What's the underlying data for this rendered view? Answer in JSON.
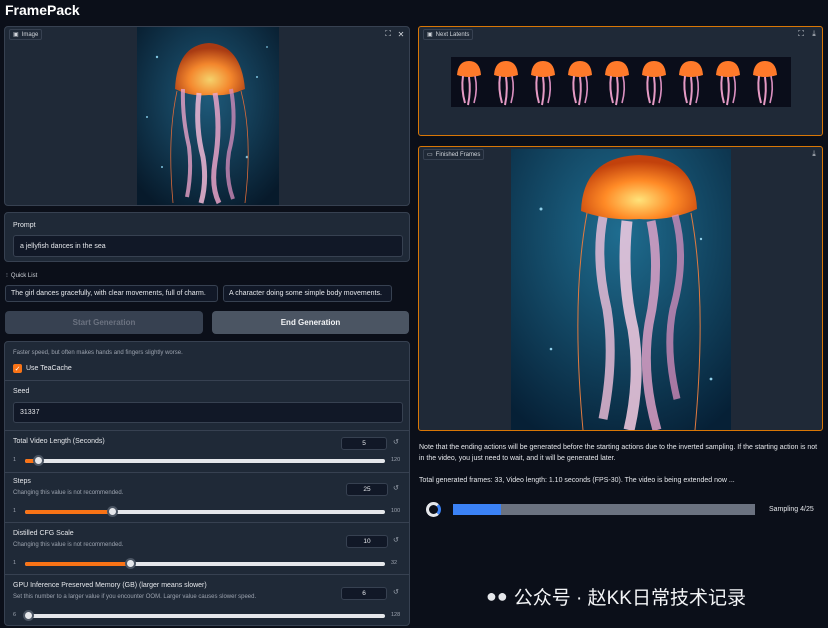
{
  "app": {
    "title": "FramePack"
  },
  "image_panel": {
    "label": "Image"
  },
  "latents_panel": {
    "label": "Next Latents"
  },
  "frames_panel": {
    "label": "Finished Frames"
  },
  "prompt": {
    "label": "Prompt",
    "value": "a jellyfish dances in the sea"
  },
  "quick_list": {
    "label": "Quick List",
    "items": [
      "The girl dances gracefully, with clear movements, full of charm.",
      "A character doing some simple body movements."
    ]
  },
  "buttons": {
    "start": "Start Generation",
    "end": "End Generation"
  },
  "teacache": {
    "hint": "Faster speed, but often makes hands and fingers slightly worse.",
    "label": "Use TeaCache",
    "checked": true
  },
  "seed": {
    "label": "Seed",
    "value": "31337"
  },
  "video_length": {
    "label": "Total Video Length (Seconds)",
    "value": "5",
    "min": "1",
    "max": "120"
  },
  "steps": {
    "label": "Steps",
    "hint": "Changing this value is not recommended.",
    "value": "25",
    "min": "1",
    "max": "100"
  },
  "cfg": {
    "label": "Distilled CFG Scale",
    "hint": "Changing this value is not recommended.",
    "value": "10",
    "min": "1",
    "max": "32"
  },
  "gpu_memory": {
    "label": "GPU Inference Preserved Memory (GB) (larger means slower)",
    "hint": "Set this number to a larger value if you encounter OOM. Larger value causes slower speed.",
    "value": "6",
    "min": "6",
    "max": "128"
  },
  "note": "Note that the ending actions will be generated before the starting actions due to the inverted sampling. If the starting action is not in the video, you just need to wait, and it will be generated later.",
  "status": "Total generated frames: 33, Video length: 1.10 seconds (FPS-30). The video is being extended now ...",
  "progress": {
    "label": "Sampling 4/25",
    "fraction": 0.16
  },
  "watermark": "公众号 · 赵KK日常技术记录",
  "colors": {
    "accent": "#f97316",
    "progress": "#3b82f6",
    "panel_border_active": "#d97706"
  },
  "icons": [
    "image-icon",
    "fullscreen-icon",
    "close-icon",
    "download-icon",
    "video-icon",
    "reset-icon",
    "spinner-icon",
    "wechat-icon"
  ]
}
